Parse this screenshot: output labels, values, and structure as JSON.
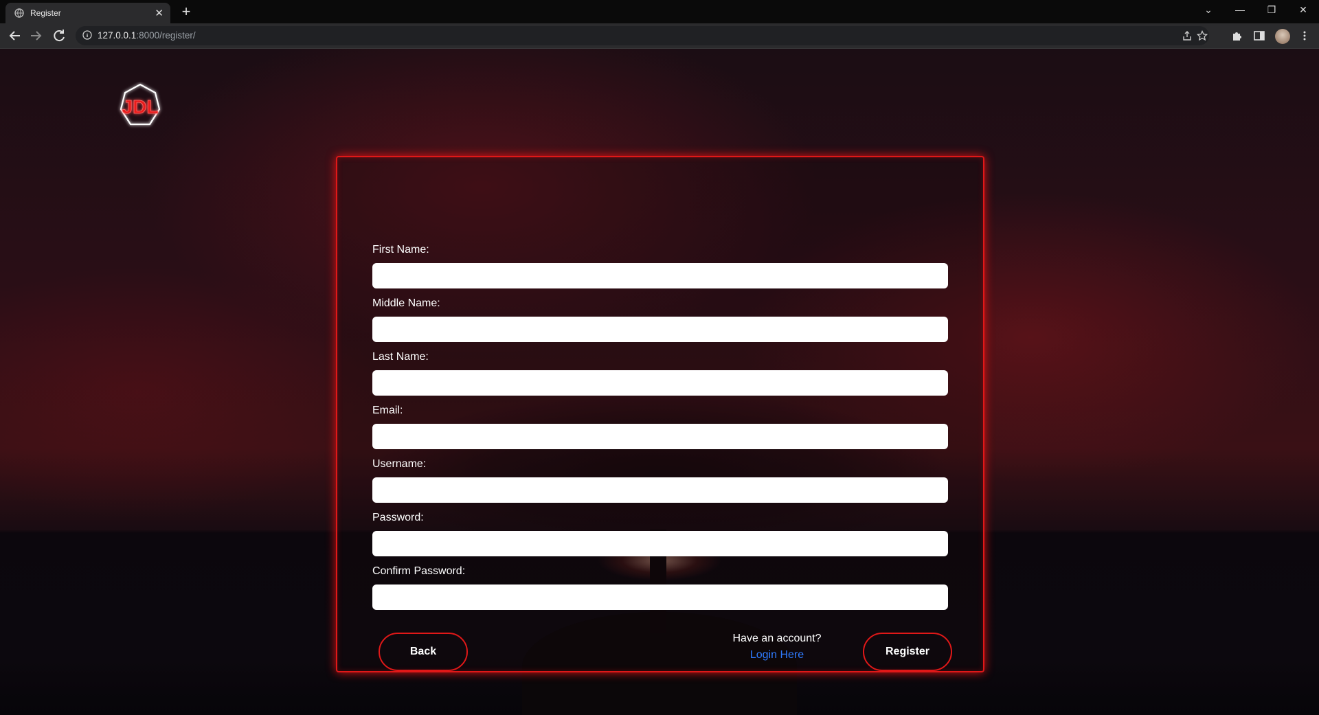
{
  "browser": {
    "tab_title": "Register",
    "tab_close": "✕",
    "new_tab": "+",
    "url_host": "127.0.0.1",
    "url_path": ":8000/register/",
    "window_controls": [
      "⌄",
      "—",
      "❐",
      "✕"
    ]
  },
  "form": {
    "fields": [
      {
        "label": "First Name:",
        "value": ""
      },
      {
        "label": "Middle Name:",
        "value": ""
      },
      {
        "label": "Last Name:",
        "value": ""
      },
      {
        "label": "Email:",
        "value": ""
      },
      {
        "label": "Username:",
        "value": ""
      },
      {
        "label": "Password:",
        "value": ""
      },
      {
        "label": "Confirm Password:",
        "value": ""
      }
    ],
    "back_label": "Back",
    "register_label": "Register",
    "have_account": "Have an account?",
    "login_link": "Login Here"
  },
  "logo": {
    "text": "JDL"
  },
  "colors": {
    "accent": "#e01818",
    "link": "#2f7bff"
  }
}
